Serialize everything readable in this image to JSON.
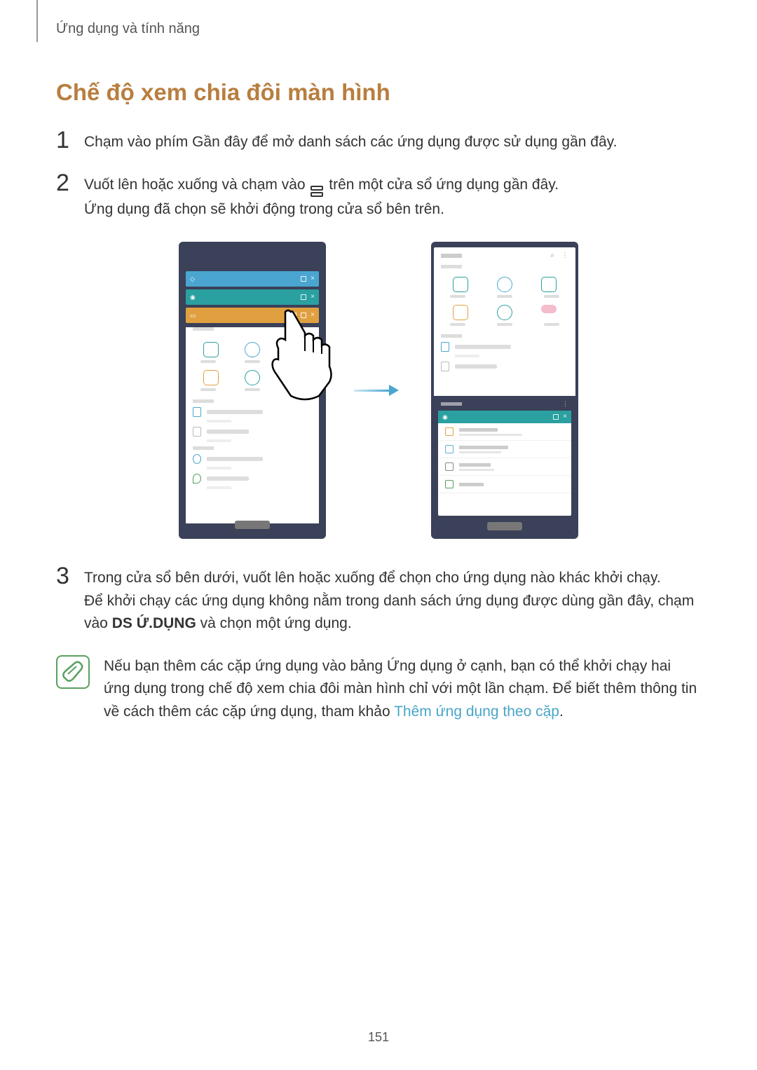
{
  "breadcrumb": "Ứng dụng và tính năng",
  "title": "Chế độ xem chia đôi màn hình",
  "steps": {
    "s1": {
      "num": "1",
      "text": "Chạm vào phím Gần đây để mở danh sách các ứng dụng được sử dụng gần đây."
    },
    "s2": {
      "num": "2",
      "text_a": "Vuốt lên hoặc xuống và chạm vào ",
      "text_b": " trên một cửa sổ ứng dụng gần đây.",
      "text_c": "Ứng dụng đã chọn sẽ khởi động trong cửa sổ bên trên."
    },
    "s3": {
      "num": "3",
      "text_a": "Trong cửa sổ bên dưới, vuốt lên hoặc xuống để chọn cho ứng dụng nào khác khởi chạy.",
      "text_b": "Để khởi chạy các ứng dụng không nằm trong danh sách ứng dụng được dùng gần đây, chạm vào ",
      "bold": "DS Ứ.DỤNG",
      "text_c": " và chọn một ứng dụng."
    }
  },
  "note": {
    "text_a": "Nếu bạn thêm các cặp ứng dụng vào bảng Ứng dụng ở cạnh, bạn có thể khởi chạy hai ứng dụng trong chế độ xem chia đôi màn hình chỉ với một lần chạm. Để biết thêm thông tin về cách thêm các cặp ứng dụng, tham khảo ",
    "link": "Thêm ứng dụng theo cặp",
    "text_b": "."
  },
  "page_number": "151"
}
